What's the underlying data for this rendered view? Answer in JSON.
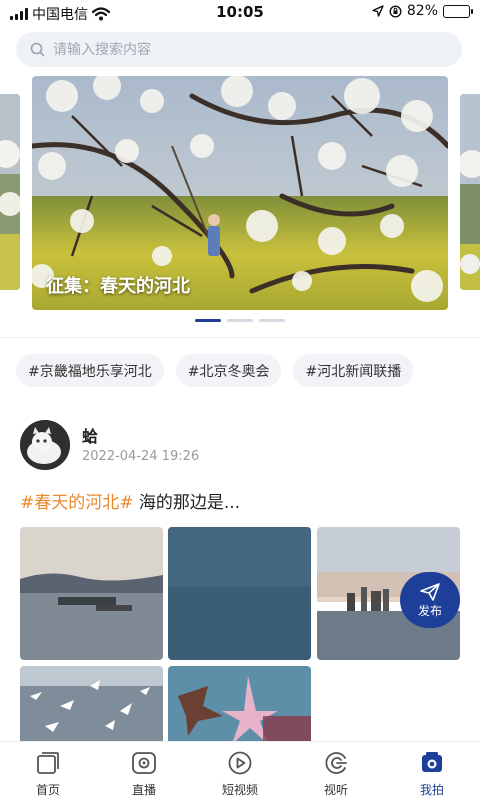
{
  "status_bar": {
    "carrier": "中国电信",
    "time": "10:05",
    "battery": "82%",
    "battery_level": 0.82
  },
  "search": {
    "placeholder": "请输入搜索内容"
  },
  "banner": {
    "caption": "征集：春天的河北",
    "page_count": 3,
    "active_index": 0
  },
  "tags": [
    "#京畿福地乐享河北",
    "#北京冬奥会",
    "#河北新闻联播"
  ],
  "post": {
    "username": "蛤",
    "time": "2022-04-24 19:26",
    "hashtag": "#春天的河北#",
    "text": "海的那边是..."
  },
  "publish_button": {
    "label": "发布"
  },
  "tabbar": {
    "items": [
      {
        "label": "首页",
        "icon": "home-icon"
      },
      {
        "label": "直播",
        "icon": "live-icon"
      },
      {
        "label": "短视频",
        "icon": "short-video-icon"
      },
      {
        "label": "视听",
        "icon": "audio-visual-icon"
      },
      {
        "label": "我拍",
        "icon": "camera-icon"
      }
    ],
    "active_index": 4
  },
  "colors": {
    "accent": "#1d3f9a",
    "hashtag": "#e98a2e"
  }
}
